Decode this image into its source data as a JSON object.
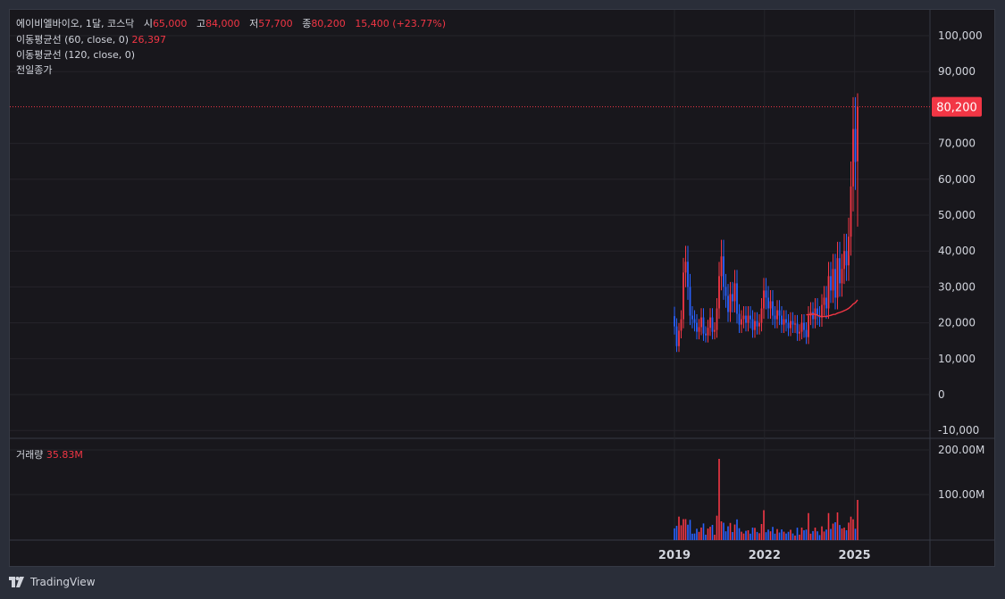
{
  "legend": {
    "symbol": "에이비엘바이오, 1달, 코스닥",
    "open_label": "시",
    "open": "65,000",
    "high_label": "고",
    "high": "84,000",
    "low_label": "저",
    "low": "57,700",
    "close_label": "종",
    "close": "80,200",
    "change": "15,400 (+23.77%)",
    "ma60_label": "이동평균선 (60, close, 0)",
    "ma60_value": "26,397",
    "ma120_label": "이동평균선 (120, close, 0)",
    "prev_close_label": "전일종가",
    "volume_label": "거래량",
    "volume_value": "35.83M"
  },
  "price_axis": {
    "ticks": [
      {
        "v": 100000,
        "label": "100,000"
      },
      {
        "v": 90000,
        "label": "90,000"
      },
      {
        "v": 70000,
        "label": "70,000"
      },
      {
        "v": 60000,
        "label": "60,000"
      },
      {
        "v": 50000,
        "label": "50,000"
      },
      {
        "v": 40000,
        "label": "40,000"
      },
      {
        "v": 30000,
        "label": "30,000"
      },
      {
        "v": 20000,
        "label": "20,000"
      },
      {
        "v": 10000,
        "label": "10,000"
      },
      {
        "v": 0,
        "label": "0"
      },
      {
        "v": -10000,
        "label": "-10,000"
      }
    ],
    "current_label": "80,200",
    "current_value": 80200
  },
  "volume_axis": {
    "ticks": [
      {
        "v": 200,
        "label": "200.00M"
      },
      {
        "v": 100,
        "label": "100.00M"
      }
    ]
  },
  "date_axis": [
    {
      "year": 2019,
      "label": "2019"
    },
    {
      "year": 2022,
      "label": "2022"
    },
    {
      "year": 2025,
      "label": "2025"
    }
  ],
  "brand": "TradingView",
  "colors": {
    "up": "#f23645",
    "down": "#2962ff",
    "ma60": "#f23645",
    "grid": "#25242a",
    "axis_text": "#d1d4dc"
  },
  "chart_data": {
    "type": "candlestick",
    "interval": "1달",
    "closes": [
      19000,
      13500,
      17800,
      21000,
      34000,
      37000,
      30000,
      22000,
      21000,
      20000,
      17500,
      18800,
      21500,
      17000,
      16500,
      18600,
      21500,
      17500,
      18000,
      24000,
      33000,
      38500,
      30000,
      27500,
      23000,
      28000,
      26000,
      31000,
      22500,
      19500,
      21000,
      22000,
      20000,
      22000,
      21000,
      18000,
      20500,
      19000,
      20000,
      24000,
      29000,
      27000,
      24000,
      26000,
      22000,
      21000,
      23500,
      22000,
      19500,
      21000,
      20000,
      18500,
      20500,
      19500,
      19800,
      17000,
      17500,
      20000,
      18000,
      16000,
      22000,
      23000,
      21000,
      24000,
      22000,
      21500,
      25000,
      27000,
      24000,
      33000,
      29000,
      35000,
      27000,
      38000,
      31000,
      35000,
      40000,
      36000,
      44000,
      58000,
      74000,
      64800,
      80200
    ],
    "ma60": {
      "start_index": 59,
      "end": 26397
    }
  }
}
